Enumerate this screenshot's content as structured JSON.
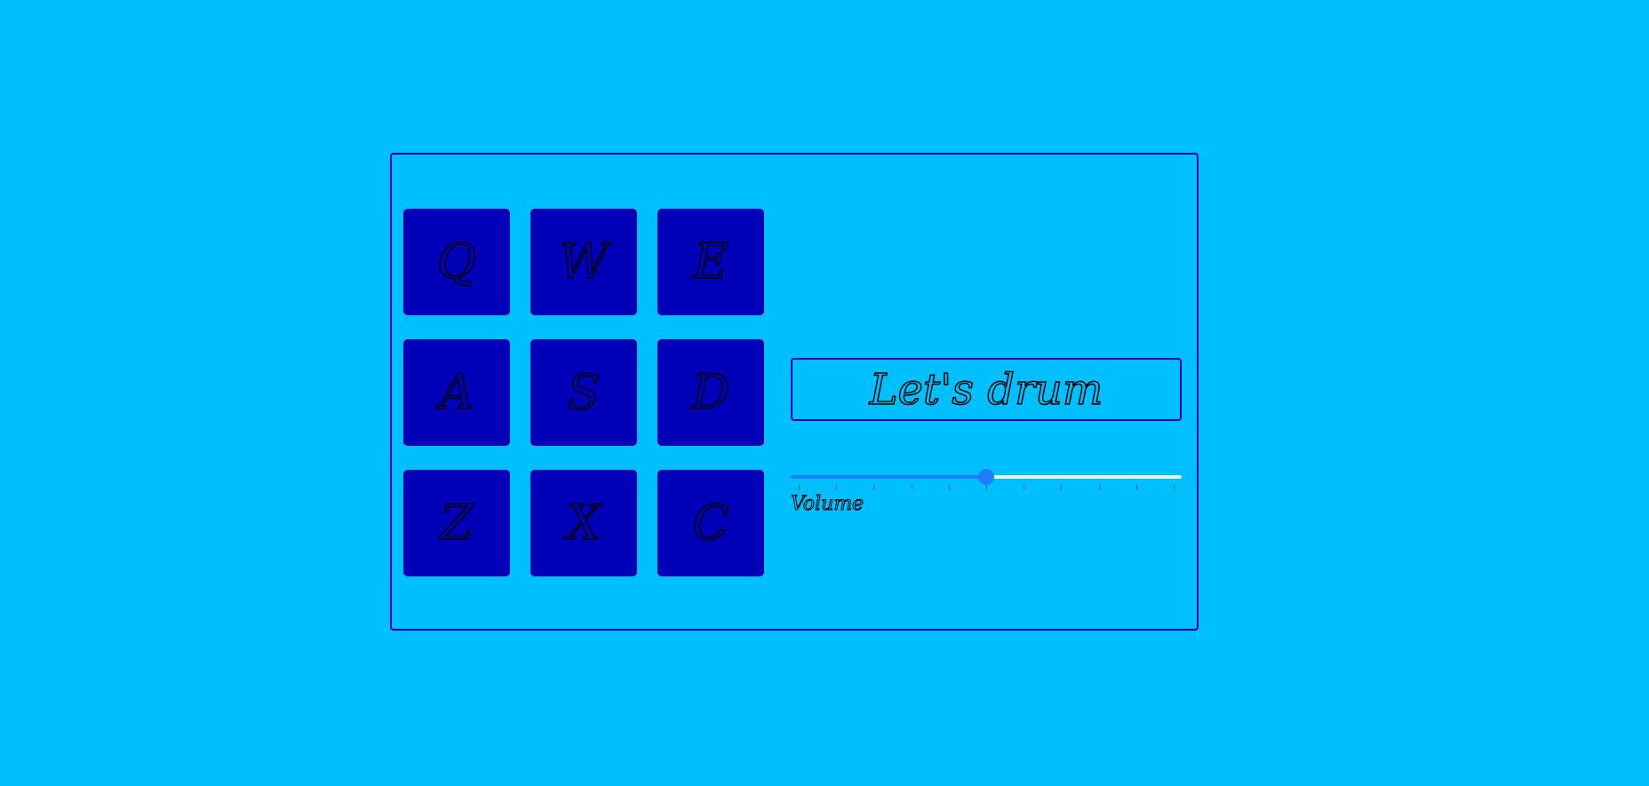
{
  "pads": [
    {
      "key": "Q"
    },
    {
      "key": "W"
    },
    {
      "key": "E"
    },
    {
      "key": "A"
    },
    {
      "key": "S"
    },
    {
      "key": "D"
    },
    {
      "key": "Z"
    },
    {
      "key": "X"
    },
    {
      "key": "C"
    }
  ],
  "display": {
    "text": "Let's drum"
  },
  "volume": {
    "label": "Volume",
    "value": 0.5,
    "ticks": 11
  },
  "colors": {
    "background": "#00BFFF",
    "pad": "#0000B8",
    "border": "#0000B8",
    "slider_accent": "#1E7CFF"
  }
}
